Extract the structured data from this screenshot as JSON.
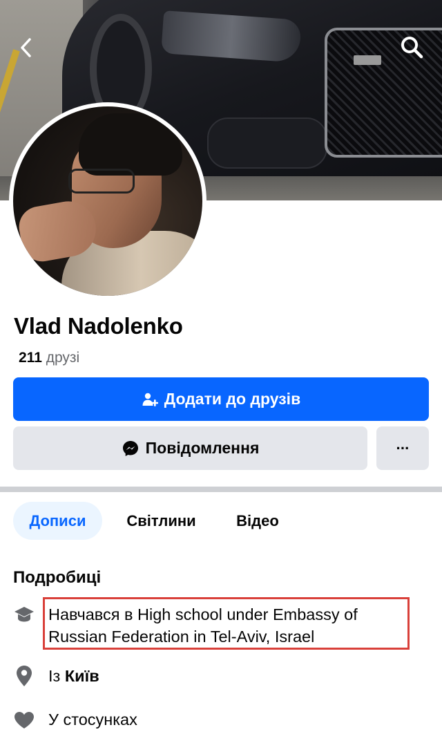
{
  "profile": {
    "name": "Vlad Nadolenko",
    "friends_count": "211",
    "friends_label": "друзі"
  },
  "buttons": {
    "add_friend": "Додати до друзів",
    "message": "Повідомлення",
    "more": "···"
  },
  "tabs": [
    {
      "label": "Дописи",
      "active": true
    },
    {
      "label": "Світлини",
      "active": false
    },
    {
      "label": "Відео",
      "active": false
    }
  ],
  "details": {
    "title": "Подробиці",
    "education": "Навчався в High school under Embassy of Russian Federation in Tel-Aviv, Israel",
    "location_prefix": "Із",
    "location_city": "Київ",
    "relationship": "У стосунках"
  },
  "colors": {
    "primary": "#0866ff",
    "secondary_btn": "#e4e6eb",
    "active_tab_bg": "#ebf5ff",
    "highlight_border": "#d9403a",
    "muted_text": "#65676b",
    "icon_gray": "#65676b"
  },
  "icons": {
    "back": "chevron-left-icon",
    "search": "search-icon",
    "add_friend": "add-friend-icon",
    "messenger": "messenger-icon",
    "education": "graduation-cap-icon",
    "location": "map-pin-icon",
    "relationship": "heart-icon"
  }
}
